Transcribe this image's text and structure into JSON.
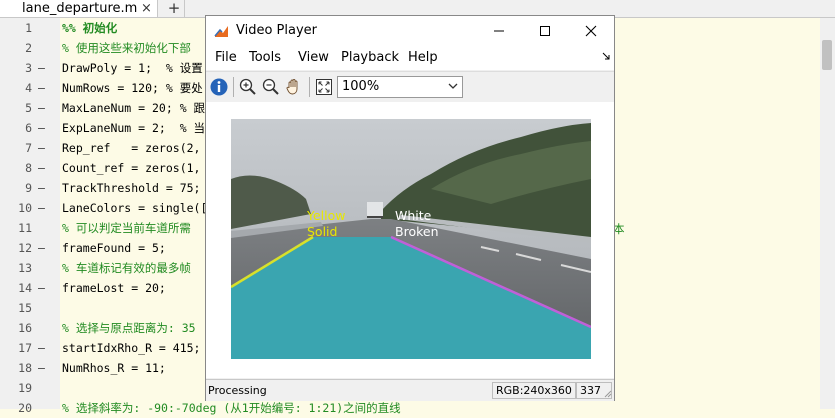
{
  "editor": {
    "tab_name": "lane_departure.m",
    "tab_close": "×",
    "tab_add": "+",
    "lines": [
      {
        "n": "1",
        "mark": "",
        "text": "%% 初始化",
        "kind": "cell"
      },
      {
        "n": "2",
        "mark": "",
        "text": "% 使用这些来初始化下部",
        "kind": "comment"
      },
      {
        "n": "3",
        "mark": "–",
        "text": "DrawPoly = 1;  % 设置",
        "kind": "code"
      },
      {
        "n": "4",
        "mark": "–",
        "text": "NumRows = 120; % 要处",
        "kind": "code"
      },
      {
        "n": "5",
        "mark": "–",
        "text": "MaxLaneNum = 20; % 跟",
        "kind": "code"
      },
      {
        "n": "6",
        "mark": "–",
        "text": "ExpLaneNum = 2;  % 当",
        "kind": "code"
      },
      {
        "n": "7",
        "mark": "–",
        "text": "Rep_ref   = zeros(2,",
        "kind": "code"
      },
      {
        "n": "8",
        "mark": "–",
        "text": "Count_ref = zeros(1,",
        "kind": "code"
      },
      {
        "n": "9",
        "mark": "–",
        "text": "TrackThreshold = 75;",
        "kind": "code"
      },
      {
        "n": "10",
        "mark": "–",
        "text": "LaneColors = single([",
        "kind": "code"
      },
      {
        "n": "11",
        "mark": "",
        "text": "% 可以判定当前车道所需",
        "kind": "comment"
      },
      {
        "n": "12",
        "mark": "–",
        "text": "frameFound = 5;",
        "kind": "code"
      },
      {
        "n": "13",
        "mark": "",
        "text": "% 车道标记有效的最多帧",
        "kind": "comment"
      },
      {
        "n": "14",
        "mark": "–",
        "text": "frameLost = 20;",
        "kind": "code"
      },
      {
        "n": "15",
        "mark": "",
        "text": "",
        "kind": "code"
      },
      {
        "n": "16",
        "mark": "",
        "text": "% 选择与原点距离为: 35",
        "kind": "comment"
      },
      {
        "n": "17",
        "mark": "–",
        "text": "startIdxRho_R = 415;",
        "kind": "code"
      },
      {
        "n": "18",
        "mark": "–",
        "text": "NumRhos_R = 11;",
        "kind": "code"
      },
      {
        "n": "19",
        "mark": "",
        "text": "",
        "kind": "code"
      },
      {
        "n": "20",
        "mark": "",
        "text": "% 选择斜率为: -90:-70deg (从1开始编号: 1:21)之间的直线",
        "kind": "comment"
      }
    ],
    "right_snippet": "本"
  },
  "player": {
    "title": "Video Player",
    "menu": [
      "File",
      "Tools",
      "View",
      "Playback",
      "Help"
    ],
    "zoom": "100%",
    "status": "Processing",
    "resolution": "RGB:240x360",
    "frame": "337",
    "labels": {
      "left_top": "Yellow",
      "left_bottom": "Solid",
      "right_top": "White",
      "right_bottom": "Broken"
    },
    "label_colors": {
      "left": "#e8e800",
      "right": "#ffffff"
    },
    "lane_fill": "#3aa5b0"
  }
}
